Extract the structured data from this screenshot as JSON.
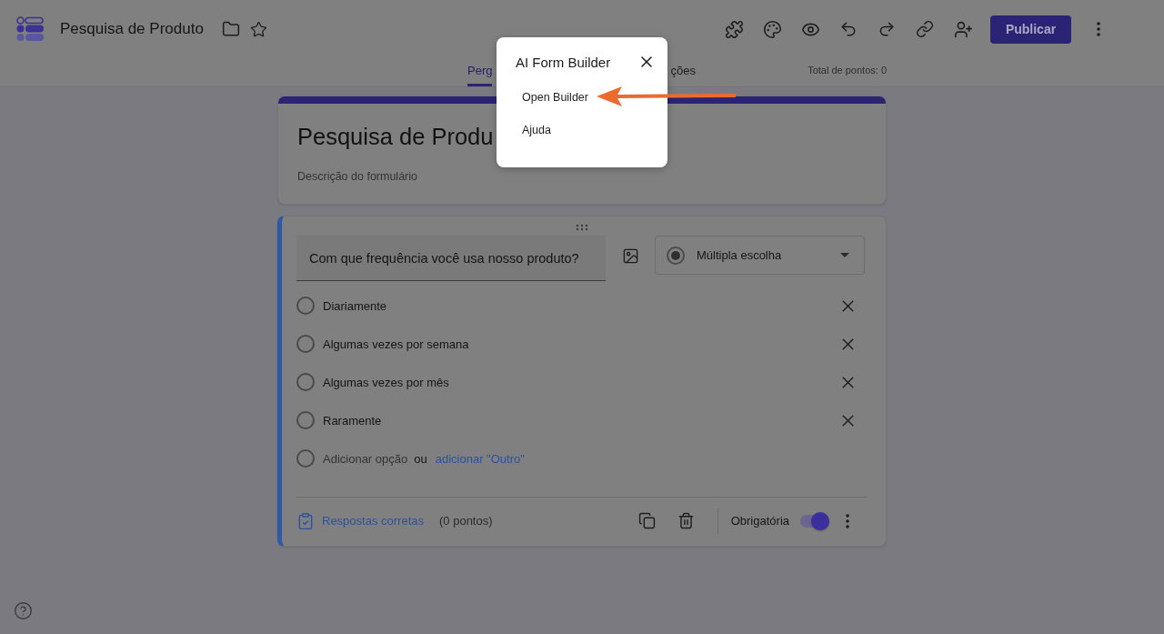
{
  "app": {
    "title": "Pesquisa de Produto"
  },
  "toolbar": {
    "publish_button": "Publicar"
  },
  "tabs": [
    {
      "label": "Perg",
      "selected": true
    },
    {
      "label": "ções",
      "selected": false
    }
  ],
  "total_points": "Total de pontos: 0",
  "form_header": {
    "title": "Pesquisa de Produ",
    "placeholder": "Descrição do formulário"
  },
  "question": {
    "title": "Com que frequência você usa nosso produto?",
    "type": "Múltipla escolha",
    "options": [
      {
        "label": "Diariamente"
      },
      {
        "label": "Algumas vezes por semana"
      },
      {
        "label": "Algumas vezes por mês"
      },
      {
        "label": "Raramente"
      }
    ],
    "add_option": {
      "placeholder": "Adicionar opção",
      "separator": "ou",
      "other_link": "adicionar \"Outro\""
    },
    "footer": {
      "answer_key": "Respostas corretas",
      "points": "(0 pontos)",
      "required_label": "Obrigatória",
      "required": true
    }
  },
  "popup": {
    "title": "AI Form Builder",
    "items": [
      "Open Builder",
      "Ajuda"
    ]
  }
}
